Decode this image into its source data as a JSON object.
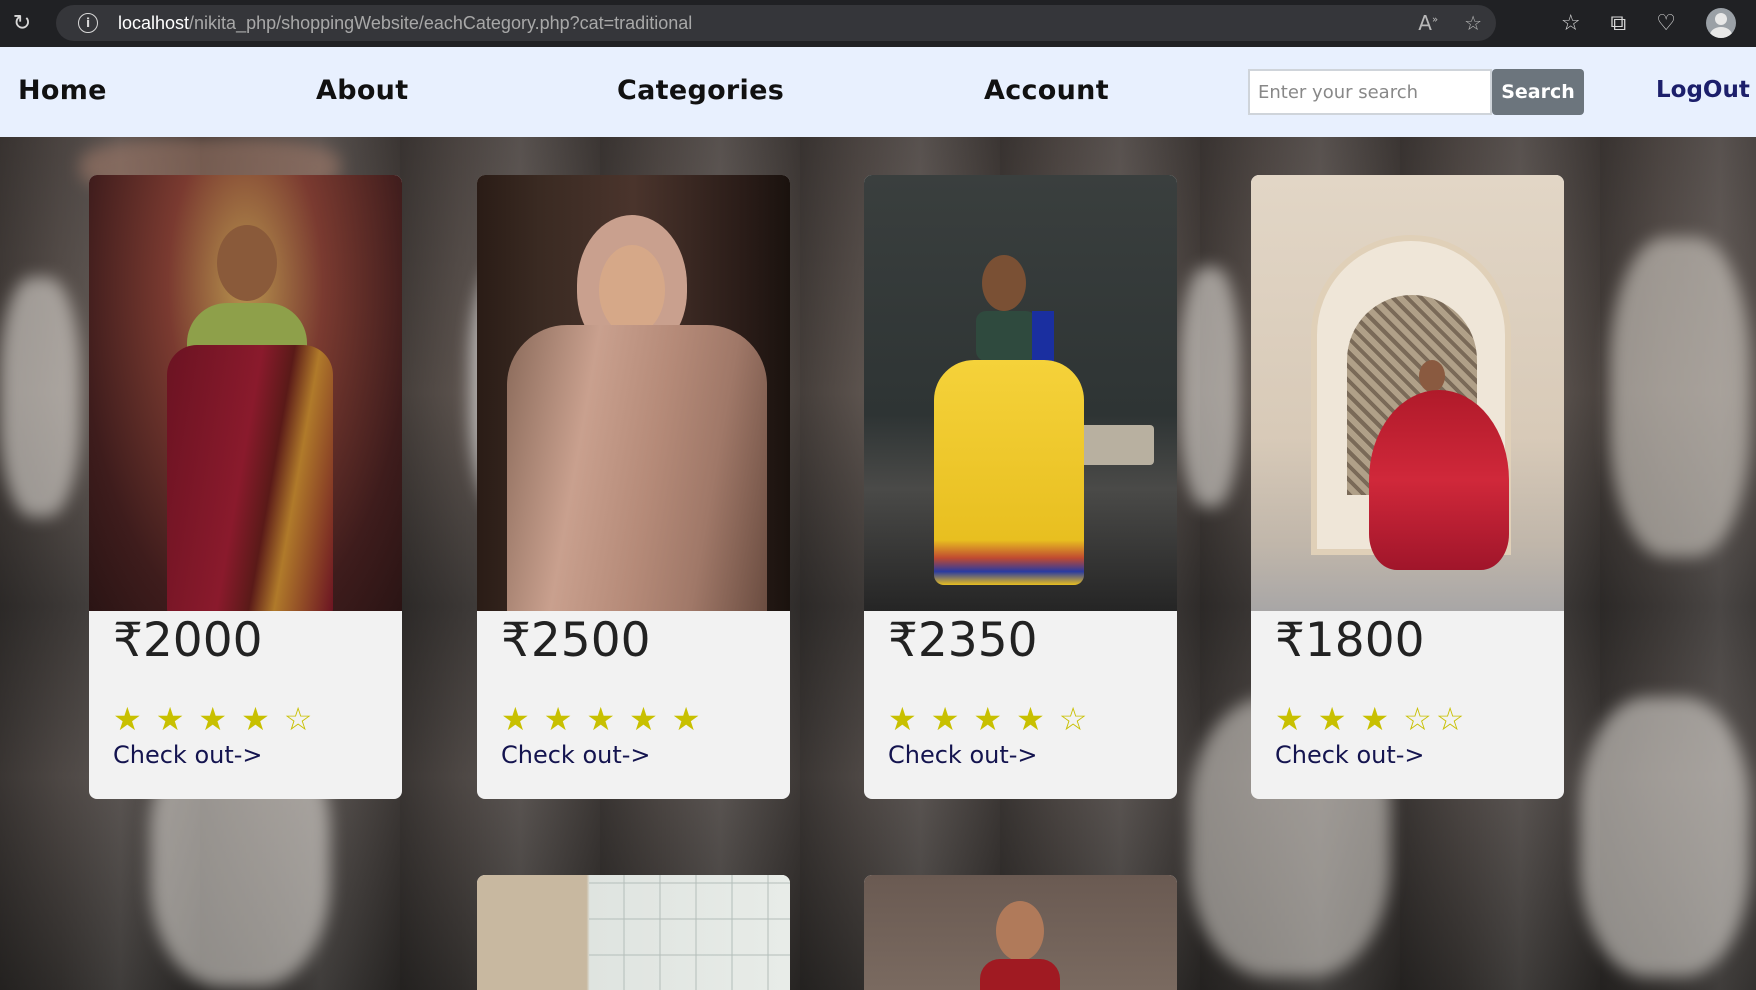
{
  "browser": {
    "url_host": "localhost",
    "url_path": "/nikita_php/shoppingWebsite/eachCategory.php?cat=traditional"
  },
  "nav": {
    "home": "Home",
    "about": "About",
    "categories": "Categories",
    "account": "Account",
    "search_placeholder": "Enter your search",
    "search_button": "Search",
    "logout": "LogOut"
  },
  "products": [
    {
      "price": "₹2000",
      "stars": "★ ★ ★ ★ ☆",
      "rating": 4,
      "link": "Check out->",
      "image": "woman-in-maroon-saree"
    },
    {
      "price": "₹2500",
      "stars": "★ ★ ★ ★ ★",
      "rating": 5,
      "link": "Check out->",
      "image": "woman-in-pink-hijab-lehenga"
    },
    {
      "price": "₹2350",
      "stars": "★ ★ ★ ★ ☆",
      "rating": 4,
      "link": "Check out->",
      "image": "woman-in-yellow-lehenga"
    },
    {
      "price": "₹1800",
      "stars": "★ ★ ★ ☆☆",
      "rating": 3,
      "link": "Check out->",
      "image": "woman-in-red-lehenga"
    }
  ],
  "colors": {
    "navbar_bg": "#e8f0fe",
    "card_bg": "#f2f2f2",
    "star": "#c8c000",
    "link": "#14144f",
    "search_button": "#6c757d"
  }
}
